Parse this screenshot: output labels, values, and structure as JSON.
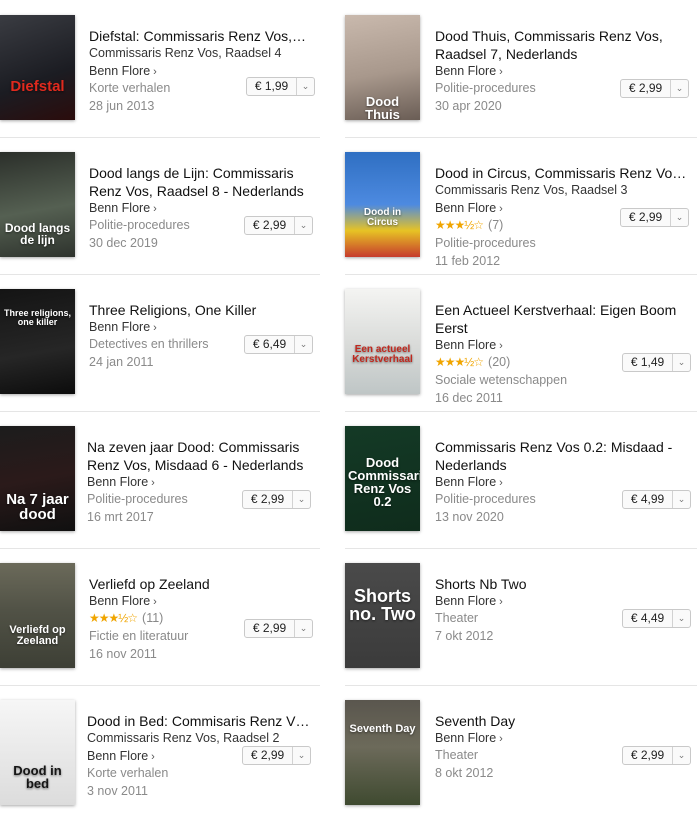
{
  "books": [
    {
      "title": "Diefstal: Commissaris Renz Vos,…",
      "series": "Commissaris Renz Vos, Raadsel 4",
      "author": "Benn Flore",
      "genre": "Korte verhalen",
      "date": "28 jun 2013",
      "price": "€ 1,99",
      "cover_text": "Diefstal"
    },
    {
      "title": "Dood Thuis, Commissaris Renz Vos, Raadsel 7, Nederlands",
      "author": "Benn Flore",
      "genre": "Politie-procedures",
      "date": "30 apr 2020",
      "price": "€ 2,99",
      "cover_text": "Dood Thuis"
    },
    {
      "title": "Dood langs de Lijn: Commissaris Renz Vos, Raadsel 8 - Nederlands",
      "author": "Benn Flore",
      "genre": "Politie-procedures",
      "date": "30 dec 2019",
      "price": "€ 2,99",
      "cover_text": "Dood langs de lijn"
    },
    {
      "title": "Dood in Circus, Commissaris Renz Vo…",
      "series": "Commissaris Renz Vos, Raadsel 3",
      "author": "Benn Flore",
      "rating_stars": "★★★½☆",
      "rating_value": 3.5,
      "rating_count": "(7)",
      "genre": "Politie-procedures",
      "date": "11 feb 2012",
      "price": "€ 2,99",
      "cover_text": "Dood in Circus"
    },
    {
      "title": "Three Religions, One Killer",
      "author": "Benn Flore",
      "genre": "Detectives en thrillers",
      "date": "24 jan 2011",
      "price": "€ 6,49",
      "cover_text": "Three religions, one killer"
    },
    {
      "title": "Een Actueel Kerstverhaal: Eigen Boom Eerst",
      "author": "Benn Flore",
      "rating_stars": "★★★½☆",
      "rating_value": 3.5,
      "rating_count": "(20)",
      "genre": "Sociale wetenschappen",
      "date": "16 dec 2011",
      "price": "€ 1,49",
      "cover_text": "Een actueel Kerstverhaal"
    },
    {
      "title": "Na zeven jaar Dood: Commissaris Renz Vos, Misdaad 6 - Nederlands",
      "author": "Benn Flore",
      "genre": "Politie-procedures",
      "date": "16 mrt 2017",
      "price": "€ 2,99",
      "cover_text": "Na 7 jaar dood"
    },
    {
      "title": "Commissaris Renz Vos 0.2: Misdaad - Nederlands",
      "author": "Benn Flore",
      "genre": "Politie-procedures",
      "date": "13 nov 2020",
      "price": "€ 4,99",
      "cover_text": "Dood Commissaris Renz Vos 0.2"
    },
    {
      "title": "Verliefd op Zeeland",
      "author": "Benn Flore",
      "rating_stars": "★★★½☆",
      "rating_value": 3.5,
      "rating_count": "(11)",
      "genre": "Fictie en literatuur",
      "date": "16 nov 2011",
      "price": "€ 2,99",
      "cover_text": "Verliefd op Zeeland"
    },
    {
      "title": "Shorts Nb Two",
      "author": "Benn Flore",
      "genre": "Theater",
      "date": "7 okt 2012",
      "price": "€ 4,49",
      "cover_text": "Shorts no. Two"
    },
    {
      "title": "Dood in Bed: Commisaris Renz V…",
      "series": "Commissaris Renz Vos, Raadsel 2",
      "author": "Benn Flore",
      "genre": "Korte verhalen",
      "date": "3 nov 2011",
      "price": "€ 2,99",
      "cover_text": "Dood in bed"
    },
    {
      "title": "Seventh Day",
      "author": "Benn Flore",
      "genre": "Theater",
      "date": "8 okt 2012",
      "price": "€ 2,99",
      "cover_text": "Seventh Day"
    }
  ],
  "ui": {
    "author_chevron": "›",
    "dropdown_icon": "⌄"
  },
  "colors": {
    "star": "#f0a500",
    "separator": "#e5e5e5",
    "muted_text": "#8a8a8a"
  }
}
